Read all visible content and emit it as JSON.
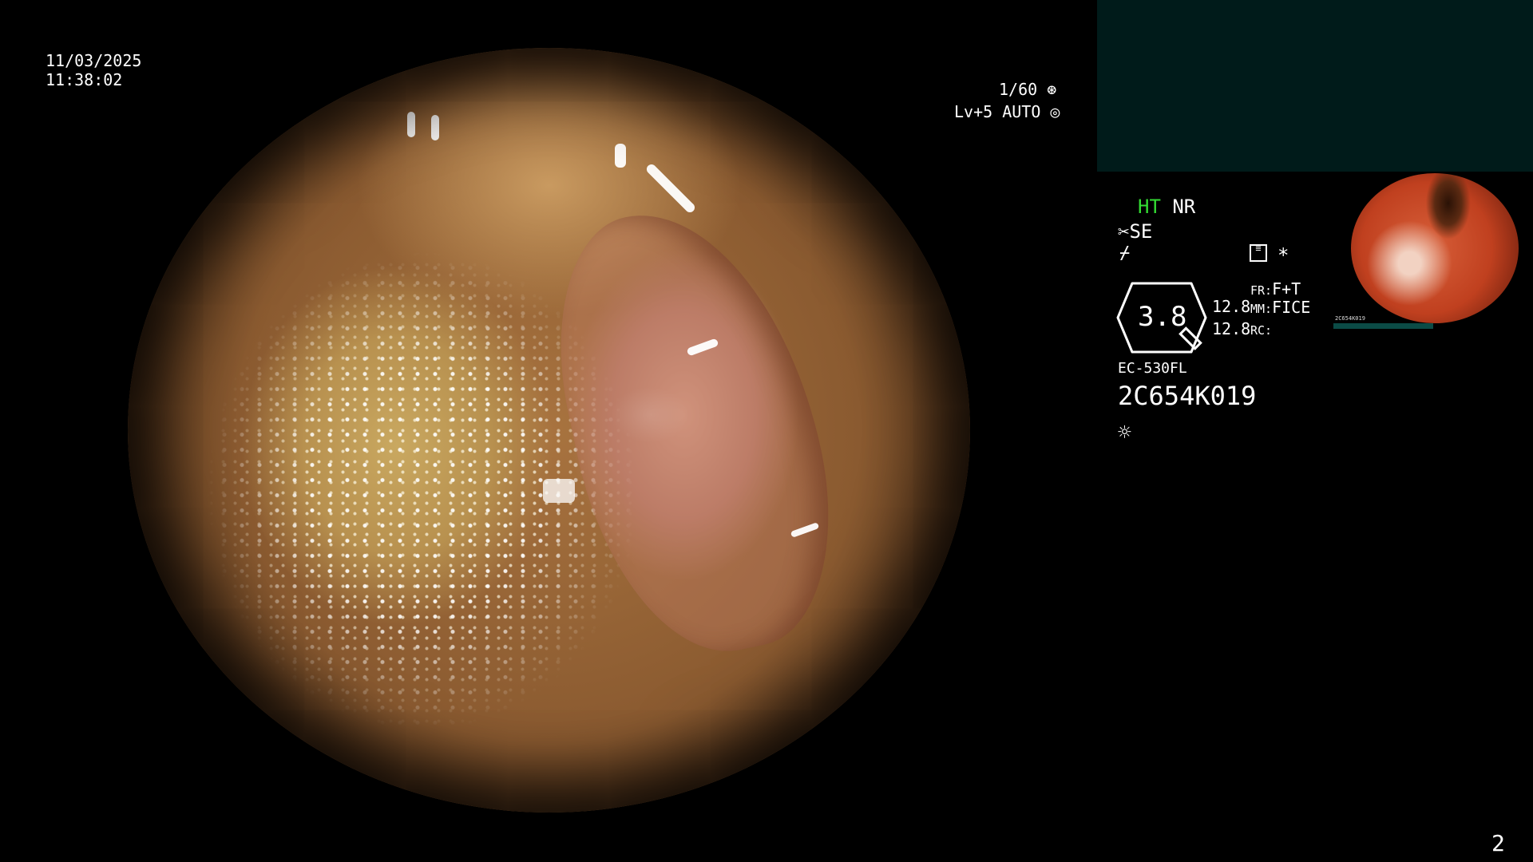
{
  "date": "11/03/2025",
  "time": "11:38:02",
  "shutter": "1/60",
  "shutter_icon": "aperture-icon",
  "level": "Lv+5 AUTO",
  "level_icon": "target-icon",
  "ht_label": "HT",
  "nr_label": "NR",
  "se_label": "SE",
  "se_icon": "scissors-icon",
  "cut_icon": "cut-mode-icon",
  "menu_icon": "settings-list-icon",
  "asterisk": "*",
  "gauge_value": "3.8",
  "value_1": "12.8",
  "value_2": "12.8",
  "fr_label": "FR:",
  "fr_value": "F+T",
  "mm_label": "MM:",
  "mm_value": "FICE",
  "rc_label": "RC:",
  "scope_model": "EC-530FL",
  "serial_number": "2C654K019",
  "light_icon": "sun-icon",
  "page_number": "2",
  "colors": {
    "ht_green": "#33dd33",
    "teal_box": "#001b1a"
  },
  "thumbnail": {
    "label_serial": "2C654K019"
  }
}
